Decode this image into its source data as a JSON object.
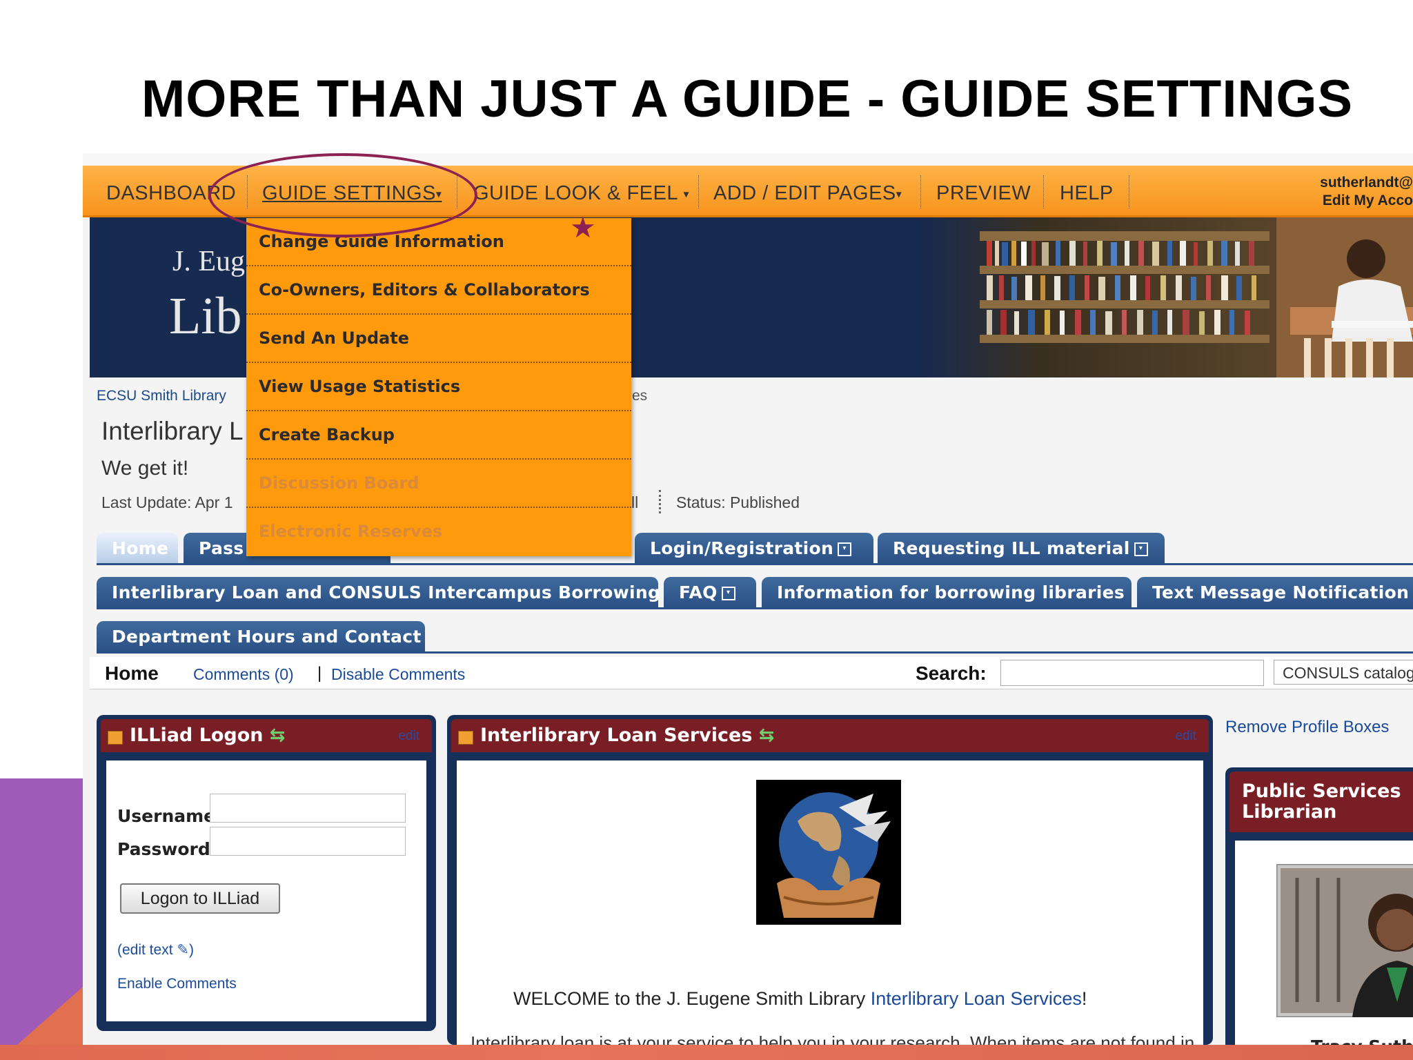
{
  "slide": {
    "title": "MORE THAN JUST A GUIDE  - GUIDE SETTINGS"
  },
  "navbar": {
    "items": [
      {
        "label": "DASHBOARD"
      },
      {
        "label": "GUIDE SETTINGS"
      },
      {
        "label": "GUIDE LOOK & FEEL"
      },
      {
        "label": "ADD / EDIT PAGES"
      },
      {
        "label": "PREVIEW"
      },
      {
        "label": "HELP"
      }
    ],
    "caret": "▾",
    "account_name": "sutherlandt@",
    "account_link": "Edit My Acco"
  },
  "dropdown": {
    "items": [
      {
        "label": "Change Guide Information",
        "enabled": true
      },
      {
        "label": "Co-Owners, Editors & Collaborators",
        "enabled": true
      },
      {
        "label": "Send An Update",
        "enabled": true
      },
      {
        "label": "View Usage Statistics",
        "enabled": true
      },
      {
        "label": "Create Backup",
        "enabled": true
      },
      {
        "label": "Discussion Board",
        "enabled": false
      },
      {
        "label": "Electronic Reserves",
        "enabled": false
      }
    ]
  },
  "banner": {
    "line1": "J. Eug",
    "line2": "Lib"
  },
  "guide": {
    "breadcrumb": "ECSU Smith Library",
    "breadcrumb_tail": "es",
    "title": "Interlibrary L",
    "subtitle": "We get it!",
    "last_update": "Last Update: Apr 1",
    "meta_tail": "ll",
    "status": "Status: Published"
  },
  "tabs": {
    "row1": [
      {
        "label": "Home",
        "active": true,
        "dropdown": false
      },
      {
        "label": "Pass",
        "active": false,
        "dropdown": false
      },
      {
        "label": "Login/Registration",
        "active": false,
        "dropdown": true
      },
      {
        "label": "Requesting ILL material",
        "active": false,
        "dropdown": true
      }
    ],
    "row2": [
      {
        "label": "Interlibrary Loan and CONSULS Intercampus Borrowing",
        "dropdown": false
      },
      {
        "label": "FAQ",
        "dropdown": true
      },
      {
        "label": "Information for borrowing libraries",
        "dropdown": false
      },
      {
        "label": "Text Message Notification",
        "dropdown": false
      }
    ],
    "row3": [
      {
        "label": "Department Hours and Contact",
        "dropdown": false
      }
    ],
    "caret": "▾"
  },
  "subbar": {
    "page": "Home",
    "comments": "Comments (0)",
    "separator": "|",
    "disable": "Disable Comments",
    "search_label": "Search:",
    "search_value": "",
    "search_scope": "CONSULS catalog"
  },
  "illiad": {
    "title": "ILLiad Logon",
    "edit": "edit",
    "username_label": "Username",
    "password_label": "Password",
    "logon_button": "Logon to ILLiad",
    "edit_text": "(edit text",
    "edit_text_close": ")",
    "enable_comments": "Enable Comments"
  },
  "ill_services": {
    "title": "Interlibrary Loan Services",
    "edit": "edit",
    "welcome_prefix": "WELCOME to the J. Eugene Smith Library ",
    "welcome_link": "Interlibrary Loan Services",
    "welcome_suffix": "!",
    "paragraph": "Interlibrary loan is at your service to help you in your research. When items are not found in the J. Eugene Smith Library collection and/or are not available through the"
  },
  "sidebar": {
    "remove_link": "Remove Profile Boxes",
    "profile_title": "Public Services Librarian",
    "profile_name": "Tracy Suther"
  },
  "colors": {
    "nav_orange": "#f7941d",
    "dropdown_orange": "#ff9a0c",
    "tab_blue": "#2b5085",
    "box_header": "#7a1e25",
    "banner_navy": "#172a50",
    "highlight": "#8b2252",
    "slide_purple": "#a05ab8",
    "slide_coral": "#e06a50"
  }
}
